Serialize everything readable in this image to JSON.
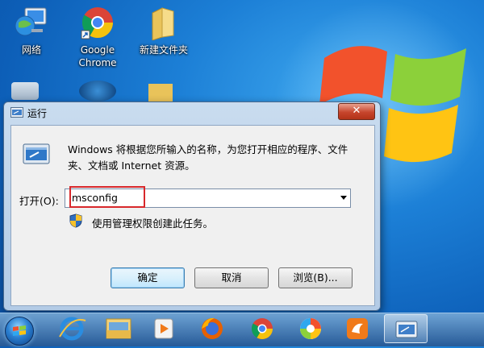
{
  "desktop": {
    "icons": [
      {
        "label": "网络"
      },
      {
        "label": "Google Chrome"
      },
      {
        "label": "新建文件夹"
      }
    ]
  },
  "run_dialog": {
    "title": "运行",
    "close_glyph": "✕",
    "description": "Windows 将根据您所输入的名称，为您打开相应的程序、文件夹、文档或 Internet 资源。",
    "open_label": "打开(O):",
    "command_value": "msconfig",
    "admin_note": "使用管理权限创建此任务。",
    "buttons": {
      "ok": "确定",
      "cancel": "取消",
      "browse": "浏览(B)..."
    }
  },
  "taskbar": {
    "items": [
      "start-orb",
      "internet-explorer",
      "file-explorer",
      "media-player",
      "firefox",
      "chrome",
      "browser-ball",
      "uc-browser",
      "run-window"
    ]
  },
  "colors": {
    "highlight_box": "#d8282b",
    "close_button": "#c7452c",
    "desktop_bg": "#1c7fd6"
  }
}
